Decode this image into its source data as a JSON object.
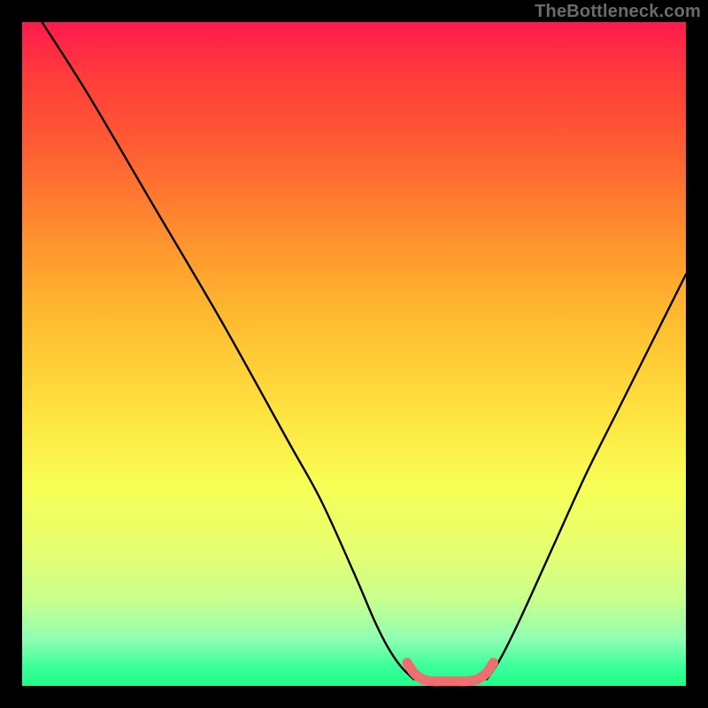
{
  "watermark": "TheBottleneck.com",
  "chart_data": {
    "type": "line",
    "title": "",
    "xlabel": "",
    "ylabel": "",
    "xlim": [
      0,
      100
    ],
    "ylim": [
      0,
      100
    ],
    "grid": false,
    "legend": false,
    "series": [
      {
        "name": "bottleneck-curve-left",
        "color": "#000000",
        "x": [
          3,
          10,
          20,
          30,
          40,
          45,
          50,
          53,
          55,
          57,
          59
        ],
        "y": [
          100,
          89,
          72,
          55,
          37,
          28,
          17,
          10,
          6,
          3,
          1
        ]
      },
      {
        "name": "bottleneck-curve-right",
        "color": "#000000",
        "x": [
          70,
          72,
          75,
          80,
          85,
          90,
          95,
          100
        ],
        "y": [
          1,
          4,
          10,
          21,
          32,
          42,
          52,
          62
        ]
      },
      {
        "name": "optimal-flat-segment",
        "color": "#ef6e6e",
        "x": [
          58,
          59,
          60,
          61,
          62,
          63,
          64,
          65,
          66,
          67,
          68,
          69,
          70,
          71
        ],
        "y": [
          3.5,
          2.0,
          1.2,
          0.8,
          0.7,
          0.7,
          0.7,
          0.7,
          0.7,
          0.7,
          0.8,
          1.2,
          2.0,
          3.5
        ]
      }
    ]
  }
}
